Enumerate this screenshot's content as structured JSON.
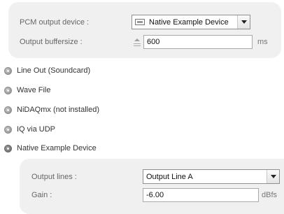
{
  "output_settings": {
    "pcm_device_label": "PCM output device :",
    "pcm_device_value": "Native Example Device",
    "buffersize_label": "Output buffersize :",
    "buffersize_value": "600",
    "buffersize_unit": "ms"
  },
  "device_options": [
    {
      "label": "Line Out (Soundcard)",
      "selected": false
    },
    {
      "label": "Wave File",
      "selected": false
    },
    {
      "label": "NiDAQmx (not installed)",
      "selected": false
    },
    {
      "label": "IQ via UDP",
      "selected": false
    },
    {
      "label": "Native Example Device",
      "selected": true
    }
  ],
  "device_settings": {
    "output_lines_label": "Output lines :",
    "output_lines_value": "Output Line A",
    "gain_label": "Gain :",
    "gain_value": "-6.00",
    "gain_unit": "dBfs"
  },
  "icons": {
    "device": "sound-device-icon",
    "spin": "spin-adjust-icon",
    "dropdown": "chevron-down-icon",
    "radio": "radio-button-icon"
  }
}
